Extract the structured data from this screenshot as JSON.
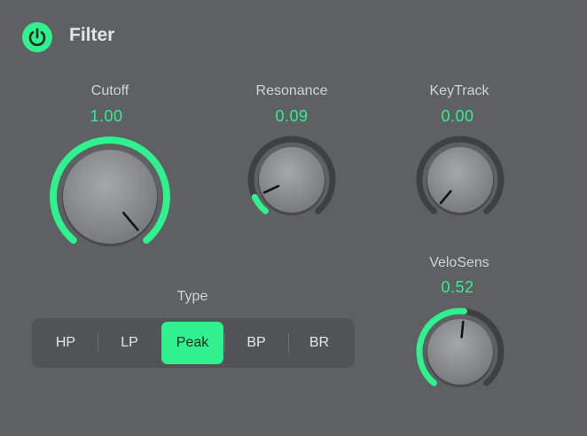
{
  "header": {
    "title": "Filter",
    "power_icon": "power-icon",
    "power_on": true
  },
  "knobs": [
    {
      "id": "cutoff",
      "label": "Cutoff",
      "value": "1.00",
      "fraction": 1.0
    },
    {
      "id": "resonance",
      "label": "Resonance",
      "value": "0.09",
      "fraction": 0.09
    },
    {
      "id": "keytrack",
      "label": "KeyTrack",
      "value": "0.00",
      "fraction": 0.0
    },
    {
      "id": "velosens",
      "label": "VeloSens",
      "value": "0.52",
      "fraction": 0.52
    }
  ],
  "type": {
    "label": "Type",
    "options": [
      "HP",
      "LP",
      "Peak",
      "BP",
      "BR"
    ],
    "selected": "Peak"
  },
  "colors": {
    "accent": "#2ff28f",
    "background": "#5f6064",
    "track": "#3f4043"
  }
}
